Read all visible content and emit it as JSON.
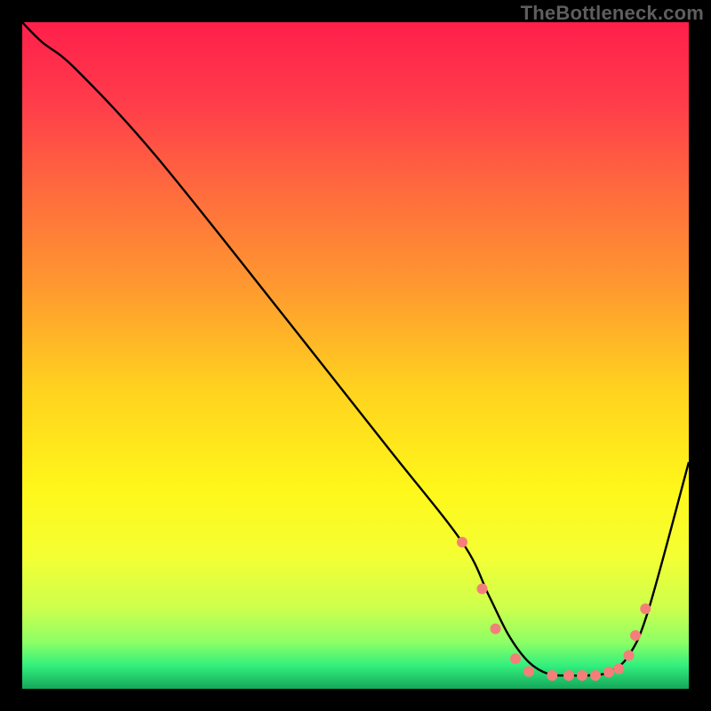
{
  "watermark": "TheBottleneck.com",
  "gradient_stops": [
    {
      "offset": 0.0,
      "color": "#ff1f4b"
    },
    {
      "offset": 0.12,
      "color": "#ff3c4b"
    },
    {
      "offset": 0.25,
      "color": "#ff6a3e"
    },
    {
      "offset": 0.4,
      "color": "#ff9a2f"
    },
    {
      "offset": 0.55,
      "color": "#ffd21f"
    },
    {
      "offset": 0.7,
      "color": "#fff71a"
    },
    {
      "offset": 0.8,
      "color": "#f4ff33"
    },
    {
      "offset": 0.88,
      "color": "#ccff4d"
    },
    {
      "offset": 0.93,
      "color": "#8dff66"
    },
    {
      "offset": 0.965,
      "color": "#33ef7d"
    },
    {
      "offset": 1.0,
      "color": "#14a85a"
    }
  ],
  "chart_data": {
    "type": "line",
    "title": "",
    "xlabel": "",
    "ylabel": "",
    "xlim": [
      0,
      100
    ],
    "ylim": [
      0,
      100
    ],
    "grid": false,
    "legend": false,
    "series": [
      {
        "name": "curve",
        "x": [
          0,
          3,
          8,
          20,
          40,
          55,
          66,
          70,
          73,
          76,
          79,
          82,
          85,
          88,
          91,
          94,
          100
        ],
        "y": [
          100,
          97,
          93,
          80,
          55,
          36,
          22,
          14,
          8,
          4,
          2.2,
          2,
          2,
          2.5,
          5,
          12,
          34
        ]
      }
    ],
    "markers": {
      "name": "markers",
      "color": "#f47f7a",
      "radius_px": 6,
      "x": [
        66,
        69,
        71,
        74,
        76,
        79.5,
        82,
        84,
        86,
        88,
        89.5,
        91,
        92,
        93.5
      ],
      "y": [
        22,
        15,
        9,
        4.5,
        2.6,
        2,
        2,
        2,
        2,
        2.5,
        3,
        5,
        8,
        12
      ]
    }
  }
}
